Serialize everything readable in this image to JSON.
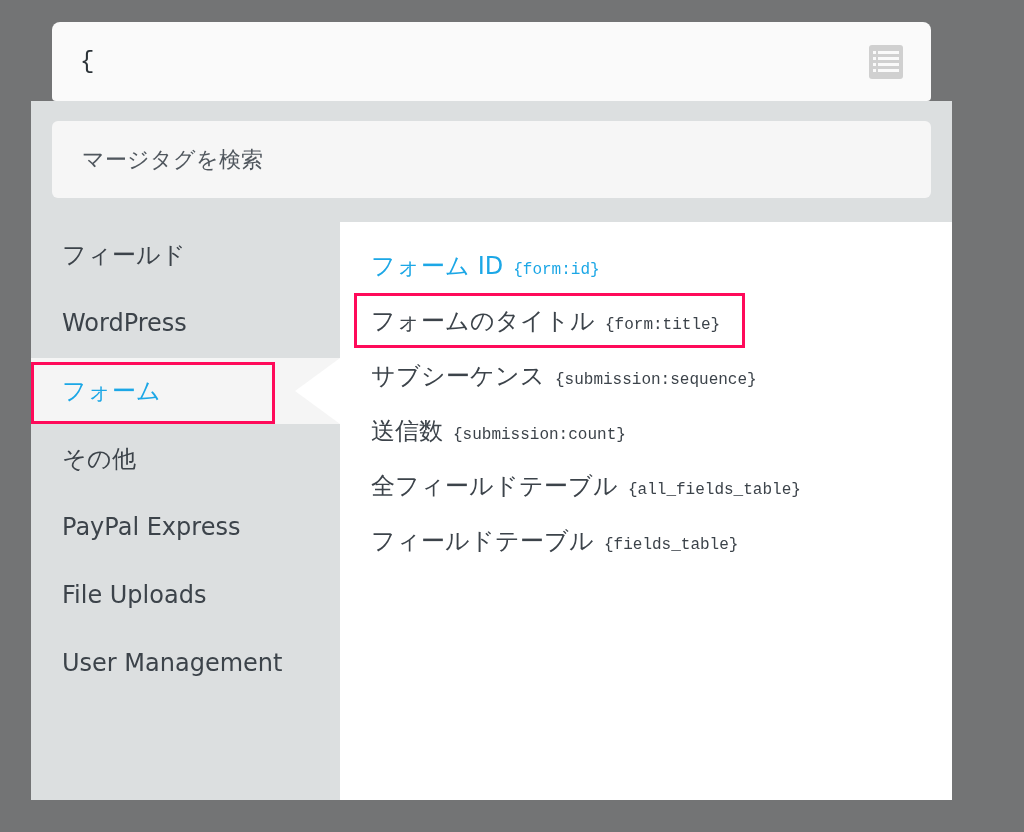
{
  "tag_field": {
    "value": "{"
  },
  "search": {
    "placeholder": "マージタグを検索"
  },
  "categories": [
    {
      "label": "フィールド",
      "selected": false,
      "highlighted": false
    },
    {
      "label": "WordPress",
      "selected": false,
      "highlighted": false
    },
    {
      "label": "フォーム",
      "selected": true,
      "highlighted": true
    },
    {
      "label": "その他",
      "selected": false,
      "highlighted": false
    },
    {
      "label": "PayPal Express",
      "selected": false,
      "highlighted": false
    },
    {
      "label": "File Uploads",
      "selected": false,
      "highlighted": false
    },
    {
      "label": "User Management",
      "selected": false,
      "highlighted": false
    }
  ],
  "tags": [
    {
      "label": "フォーム ID",
      "tag": "{form:id}",
      "active": true,
      "highlighted": false
    },
    {
      "label": "フォームのタイトル",
      "tag": "{form:title}",
      "active": false,
      "highlighted": true
    },
    {
      "label": "サブシーケンス",
      "tag": "{submission:sequence}",
      "active": false,
      "highlighted": false
    },
    {
      "label": "送信数",
      "tag": "{submission:count}",
      "active": false,
      "highlighted": false
    },
    {
      "label": "全フィールドテーブル",
      "tag": "{all_fields_table}",
      "active": false,
      "highlighted": false
    },
    {
      "label": "フィールドテーブル",
      "tag": "{fields_table}",
      "active": false,
      "highlighted": false
    }
  ]
}
